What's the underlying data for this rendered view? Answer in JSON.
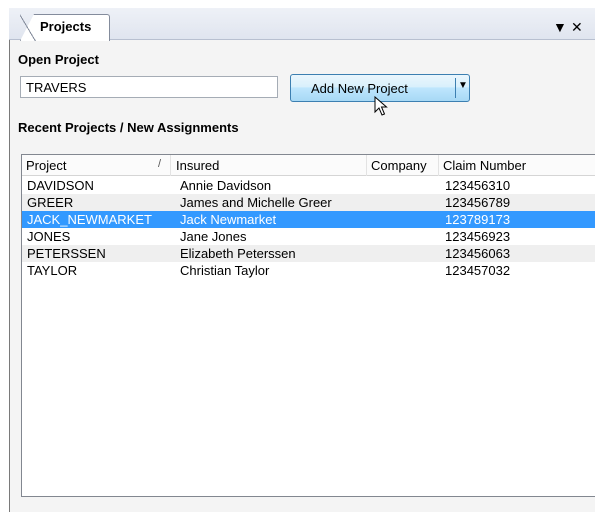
{
  "window": {
    "tab_title": "Projects",
    "pin_icon": "dropdown-pin-icon",
    "close_icon": "close-icon"
  },
  "open_project": {
    "heading": "Open Project",
    "input_value": "TRAVERS",
    "add_button_label": "Add New Project",
    "split_arrow_icon": "chevron-down-icon"
  },
  "recent": {
    "heading": "Recent Projects / New Assignments",
    "columns": [
      "Project",
      "Insured",
      "Company",
      "Claim Number"
    ],
    "sort_indicator": "/",
    "rows": [
      {
        "project": "DAVIDSON",
        "insured": "Annie Davidson",
        "company": "",
        "claim": "123456310"
      },
      {
        "project": "GREER",
        "insured": "James and Michelle Greer",
        "company": "",
        "claim": "123456789"
      },
      {
        "project": "JACK_NEWMARKET",
        "insured": "Jack Newmarket",
        "company": "",
        "claim": "123789173"
      },
      {
        "project": "JONES",
        "insured": "Jane Jones",
        "company": "",
        "claim": "123456923"
      },
      {
        "project": "PETERSSEN",
        "insured": "Elizabeth Peterssen",
        "company": "",
        "claim": "123456063"
      },
      {
        "project": "TAYLOR",
        "insured": "Christian Taylor",
        "company": "",
        "claim": "123457032"
      }
    ],
    "selected_row": "JACK_NEWMARKET"
  },
  "colors": {
    "selection": "#3399ff",
    "button_border": "#3c7fb1"
  }
}
